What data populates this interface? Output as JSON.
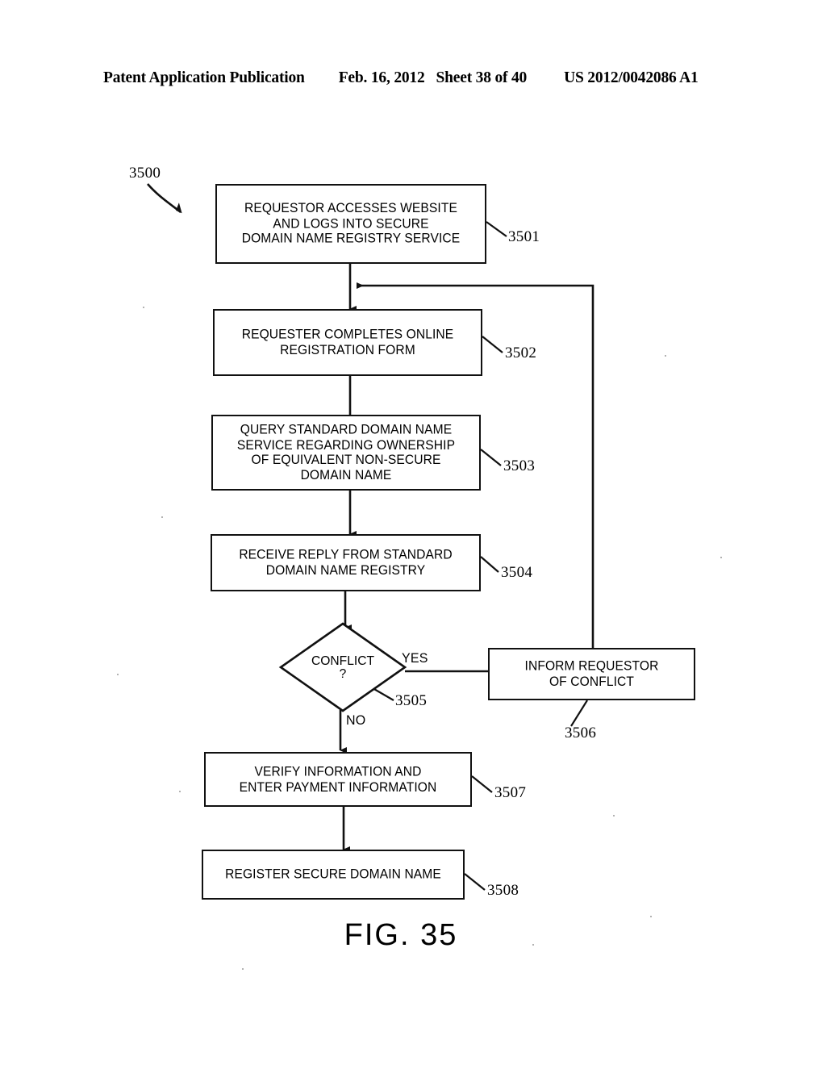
{
  "header": {
    "publication": "Patent Application Publication",
    "date": "Feb. 16, 2012",
    "sheet": "Sheet 38 of 40",
    "patent_number": "US 2012/0042086 A1"
  },
  "figure": {
    "caption": "FIG. 35",
    "diagram_label": "3500",
    "type": "flowchart"
  },
  "nodes": [
    {
      "id": "3501",
      "shape": "process",
      "text": "REQUESTOR ACCESSES WEBSITE\nAND LOGS INTO SECURE\nDOMAIN NAME REGISTRY SERVICE",
      "ref": "3501"
    },
    {
      "id": "3502",
      "shape": "process",
      "text": "REQUESTER COMPLETES ONLINE\nREGISTRATION FORM",
      "ref": "3502"
    },
    {
      "id": "3503",
      "shape": "process",
      "text": "QUERY STANDARD DOMAIN NAME\nSERVICE REGARDING OWNERSHIP\nOF EQUIVALENT NON-SECURE\nDOMAIN NAME",
      "ref": "3503"
    },
    {
      "id": "3504",
      "shape": "process",
      "text": "RECEIVE REPLY FROM STANDARD\nDOMAIN NAME REGISTRY",
      "ref": "3504"
    },
    {
      "id": "3505",
      "shape": "decision",
      "text": "CONFLICT",
      "question_mark": "?",
      "ref": "3505"
    },
    {
      "id": "3506",
      "shape": "process",
      "text": "INFORM REQUESTOR\nOF CONFLICT",
      "ref": "3506"
    },
    {
      "id": "3507",
      "shape": "process",
      "text": "VERIFY INFORMATION AND\nENTER PAYMENT INFORMATION",
      "ref": "3507"
    },
    {
      "id": "3508",
      "shape": "process",
      "text": "REGISTER SECURE DOMAIN NAME",
      "ref": "3508"
    }
  ],
  "branches": {
    "yes": "YES",
    "no": "NO"
  },
  "colors": {
    "ink": "#111111",
    "paper": "#ffffff"
  }
}
